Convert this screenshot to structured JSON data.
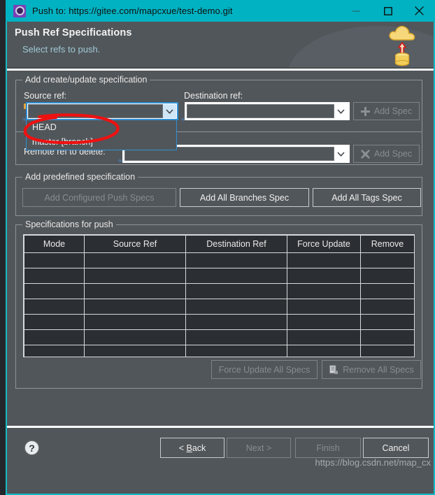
{
  "window": {
    "title": "Push to: https://gitee.com/mapcxue/test-demo.git",
    "icon": "app-gear-icon",
    "minimize": "minimize-icon",
    "maximize": "maximize-icon",
    "close": "close-icon",
    "titlebar_color": "#00b2c2"
  },
  "banner": {
    "heading": "Push Ref Specifications",
    "subtext": "Select refs to push.",
    "art": "cloud-upload-icon"
  },
  "create_update_group": {
    "legend": "Add create/update specification",
    "source_label": "Source ref:",
    "source_value": "",
    "destination_label": "Destination ref:",
    "destination_value": "",
    "add_spec_label": "Add Spec",
    "add_spec_icon": "plus-icon",
    "add_spec_enabled": "false"
  },
  "source_dropdown": {
    "open": "true",
    "options": [
      "HEAD",
      "master [branch]"
    ]
  },
  "delete_group": {
    "legend": "",
    "remote_ref_label": "Remote ref to delete:",
    "remote_ref_value": "",
    "add_spec_label": "Add Spec",
    "add_spec_icon": "cross-icon",
    "add_spec_enabled": "false"
  },
  "predefined_group": {
    "legend": "Add predefined specification",
    "buttons": [
      {
        "label": "Add Configured Push Specs",
        "enabled": "false"
      },
      {
        "label": "Add All Branches Spec",
        "enabled": "true"
      },
      {
        "label": "Add All Tags Spec",
        "enabled": "true"
      }
    ]
  },
  "specs_group": {
    "legend": "Specifications for push",
    "columns": [
      "Mode",
      "Source Ref",
      "Destination Ref",
      "Force Update",
      "Remove"
    ],
    "rows": [],
    "empty_row_count": 7,
    "force_update_all_label": "Force Update All Specs",
    "force_update_all_enabled": "false",
    "remove_all_label": "Remove All Specs",
    "remove_all_icon": "document-remove-icon",
    "remove_all_enabled": "false"
  },
  "wizard_buttons": {
    "help": "?",
    "back": "< Back",
    "back_accel": "B",
    "next": "Next >",
    "next_enabled": "false",
    "finish": "Finish",
    "finish_enabled": "false",
    "cancel": "Cancel"
  },
  "watermark": {
    "text": "https://blog.csdn.net/map_cx"
  },
  "annotation": {
    "shape": "red-ellipse-highlight",
    "color": "#ee1111",
    "targets": "master [branch] option"
  }
}
